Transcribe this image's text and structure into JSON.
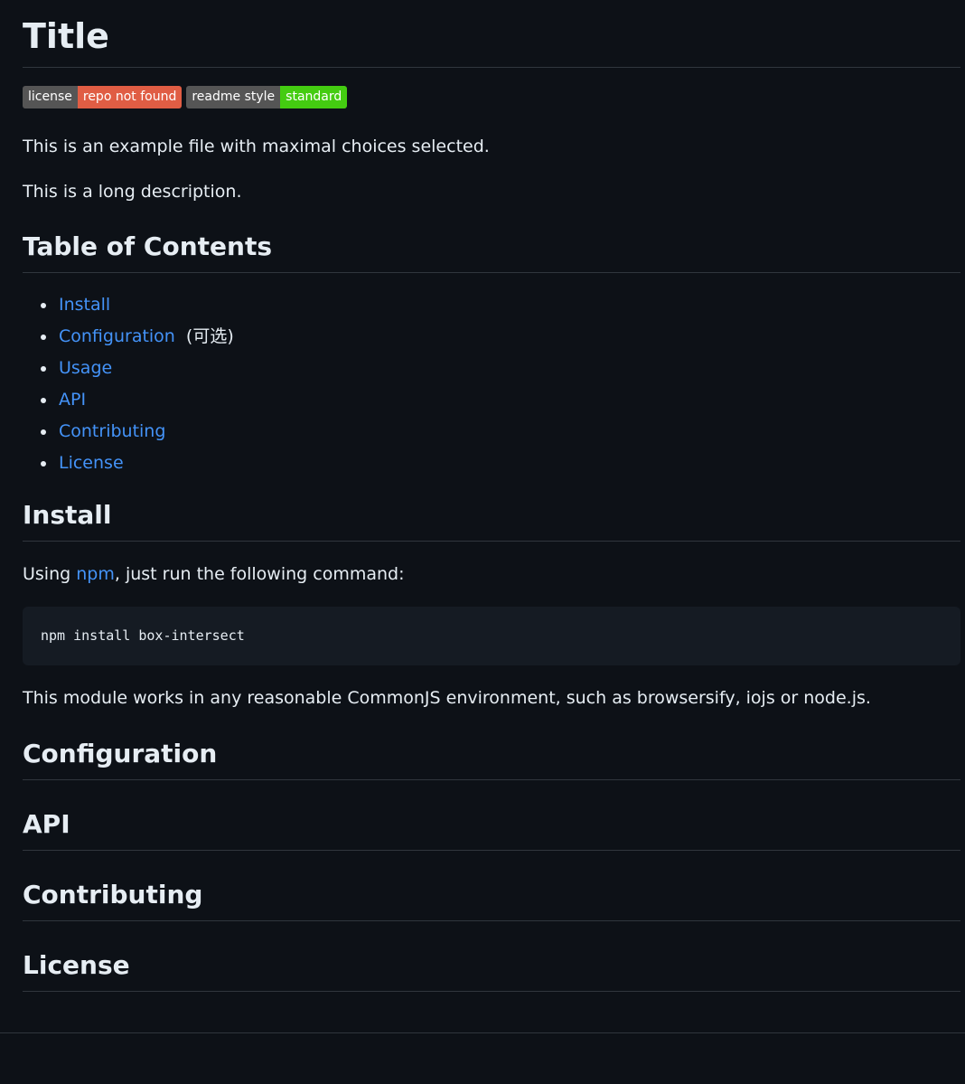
{
  "title": "Title",
  "badges": [
    {
      "label": "license",
      "value": "repo not found",
      "color": "#e05d44"
    },
    {
      "label": "readme style",
      "value": "standard",
      "color": "#44cc11"
    }
  ],
  "intro": {
    "short": "This is an example file with maximal choices selected.",
    "long": "This is a long description."
  },
  "toc": {
    "heading": "Table of Contents",
    "items": [
      {
        "label": "Install"
      },
      {
        "label": "Configuration",
        "suffix": "(可选)"
      },
      {
        "label": "Usage"
      },
      {
        "label": "API"
      },
      {
        "label": "Contributing"
      },
      {
        "label": "License"
      }
    ]
  },
  "install": {
    "heading": "Install",
    "text_before": "Using ",
    "link": "npm",
    "text_after": ", just run the following command:",
    "command": "npm install box-intersect",
    "note": "This module works in any reasonable CommonJS environment, such as browsersify, iojs or node.js."
  },
  "sections": {
    "configuration": "Configuration",
    "api": "API",
    "contributing": "Contributing",
    "license": "License"
  },
  "colors": {
    "background": "#0d1117",
    "text": "#e6edf3",
    "link": "#4493f8",
    "code_bg": "#151b23",
    "rule": "#30363d"
  }
}
